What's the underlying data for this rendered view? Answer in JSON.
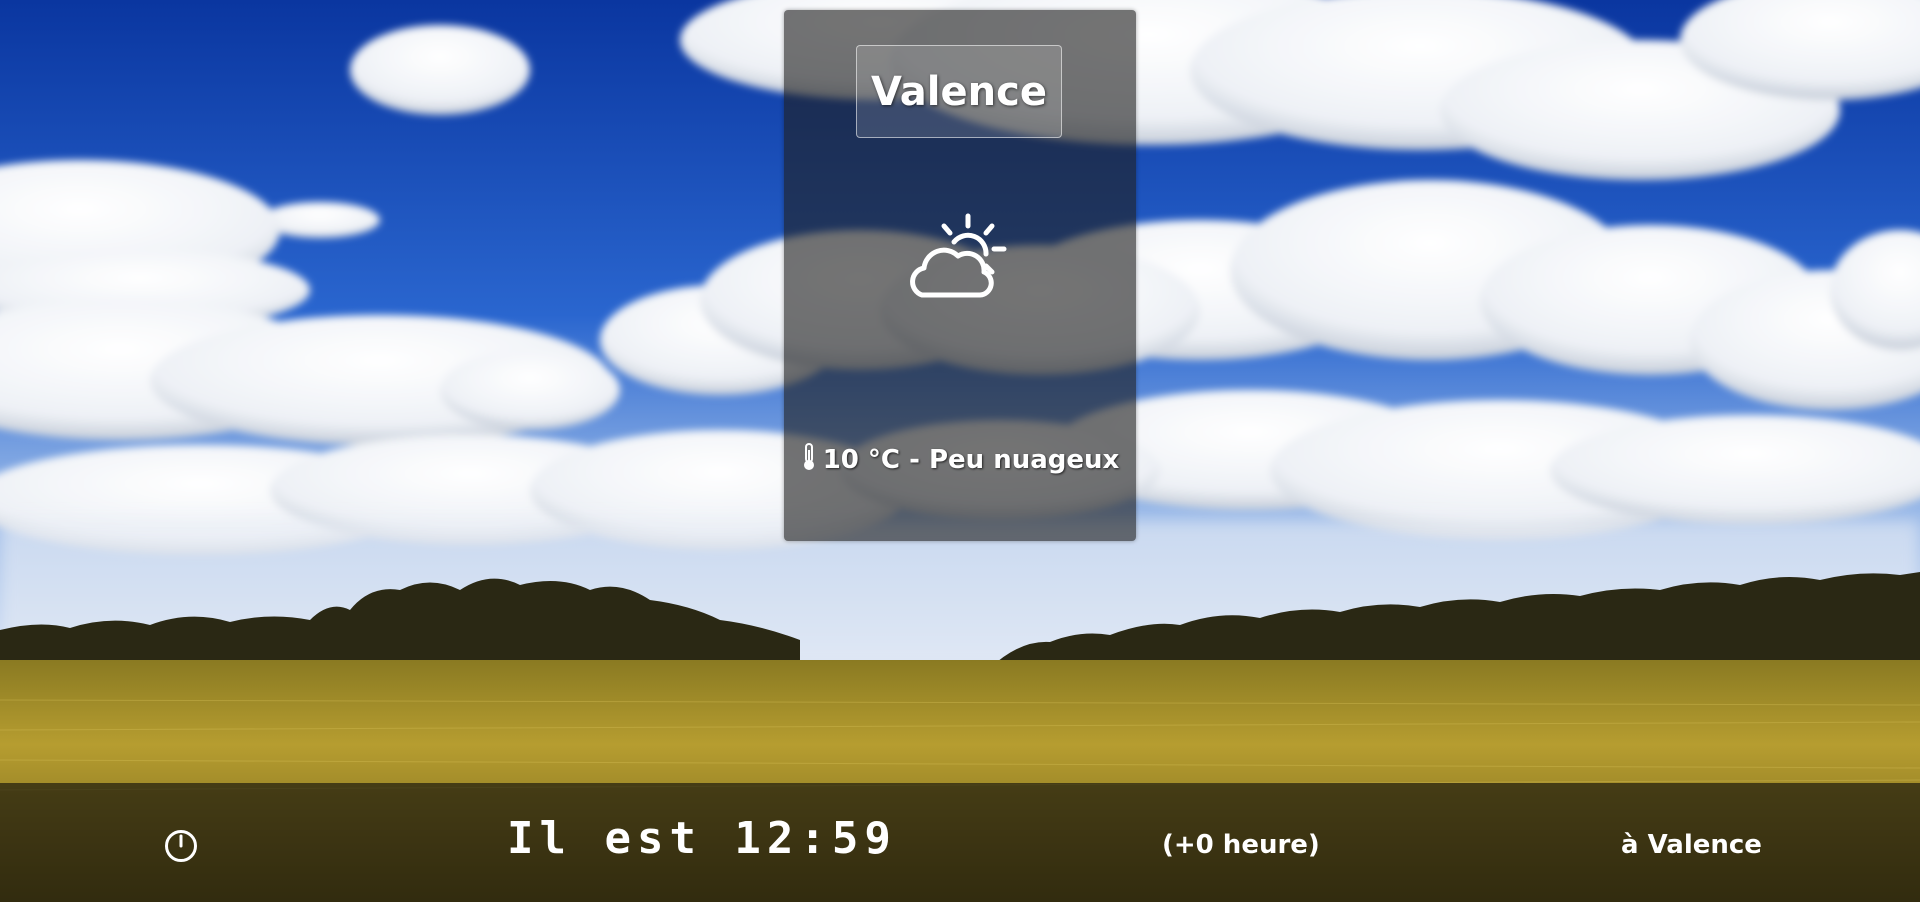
{
  "weather_card": {
    "city": "Valence",
    "icon": "partly-cloudy-icon",
    "thermometer_icon": "thermometer-icon",
    "temperature": "10 °C",
    "separator": " - ",
    "condition": "Peu nuageux"
  },
  "clock_bar": {
    "icon": "clock-icon",
    "time_label": "Il est 12:59",
    "offset_label": "(+0 heure)",
    "location_label": "à Valence"
  },
  "background": {
    "description_colors": {
      "sky_top": "#0b3fb0",
      "sky_mid": "#2e6fd6",
      "cloud": "#f2f4f8",
      "treeline": "#2c2a18",
      "grass": "#b59c2c"
    }
  }
}
